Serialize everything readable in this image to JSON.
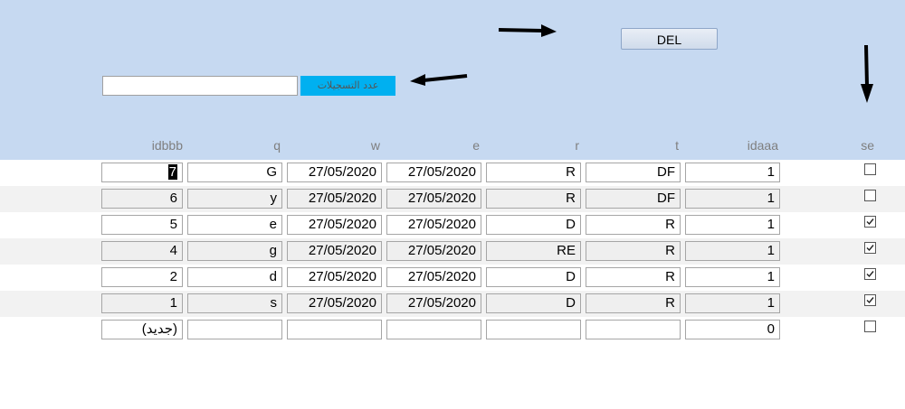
{
  "toolbar": {
    "del_label": "DEL",
    "search_value": "",
    "count_label": "عدد التسجيلات"
  },
  "columns": [
    "idbbb",
    "q",
    "w",
    "e",
    "r",
    "t",
    "idaaa",
    "se"
  ],
  "rows": [
    {
      "idbbb": "7",
      "q": "G",
      "w": "27/05/2020",
      "e": "27/05/2020",
      "r": "R",
      "t": "DF",
      "idaaa": "1",
      "se": false,
      "alt": false
    },
    {
      "idbbb": "6",
      "q": "y",
      "w": "27/05/2020",
      "e": "27/05/2020",
      "r": "R",
      "t": "DF",
      "idaaa": "1",
      "se": false,
      "alt": true
    },
    {
      "idbbb": "5",
      "q": "e",
      "w": "27/05/2020",
      "e": "27/05/2020",
      "r": "D",
      "t": "R",
      "idaaa": "1",
      "se": true,
      "alt": false
    },
    {
      "idbbb": "4",
      "q": "g",
      "w": "27/05/2020",
      "e": "27/05/2020",
      "r": "RE",
      "t": "R",
      "idaaa": "1",
      "se": true,
      "alt": true
    },
    {
      "idbbb": "2",
      "q": "d",
      "w": "27/05/2020",
      "e": "27/05/2020",
      "r": "D",
      "t": "R",
      "idaaa": "1",
      "se": true,
      "alt": false
    },
    {
      "idbbb": "1",
      "q": "s",
      "w": "27/05/2020",
      "e": "27/05/2020",
      "r": "D",
      "t": "R",
      "idaaa": "1",
      "se": true,
      "alt": true
    },
    {
      "idbbb": "(جديد)",
      "q": "",
      "w": "",
      "e": "",
      "r": "",
      "t": "",
      "idaaa": "0",
      "se": false,
      "alt": false
    }
  ],
  "icons": [
    "arrow-right-icon",
    "arrow-left-icon",
    "arrow-down-icon",
    "checkmark-icon"
  ]
}
